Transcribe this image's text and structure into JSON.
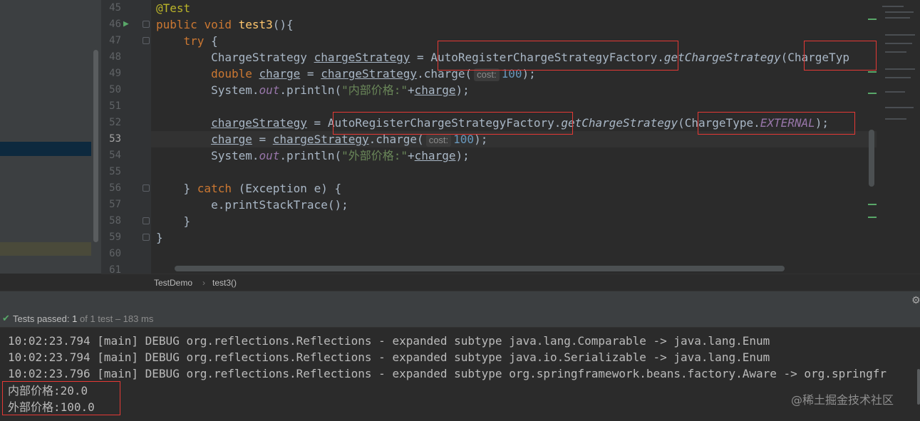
{
  "gutter": {
    "line_numbers": [
      "45",
      "46",
      "47",
      "48",
      "49",
      "50",
      "51",
      "52",
      "53",
      "54",
      "55",
      "56",
      "57",
      "58",
      "59",
      "60",
      "61"
    ],
    "current_line": "53"
  },
  "code": {
    "l45": "@Test",
    "l46_kw1": "public",
    "l46_kw2": "void",
    "l46_fn": "test3",
    "l46_rest": "(){",
    "l47_kw": "try",
    "l47_rest": " {",
    "l48_type": "ChargeStrategy ",
    "l48_var": "chargeStrategy",
    "l48_eq": " = ",
    "l48_factory": "AutoRegisterChargeStrategyFactory",
    "l48_dot": ".",
    "l48_method": "getChargeStrategy",
    "l48_arg": "(ChargeTyp",
    "l49_kw": "double",
    "l49_var": "charge",
    "l49_eq": " = ",
    "l49_obj": "chargeStrategy",
    "l49_call": ".charge(",
    "l49_hint": "cost:",
    "l49_num": "100",
    "l49_end": ");",
    "l50_a": "System.",
    "l50_out": "out",
    "l50_b": ".println(",
    "l50_str": "\"内部价格:\"",
    "l50_plus": "+",
    "l50_var": "charge",
    "l50_end": ");",
    "l52_var": "chargeStrategy",
    "l52_eq": " = ",
    "l52_factory": "AutoRegisterChargeStrategyFactory",
    "l52_dot": ".",
    "l52_method": "getChargeStrategy",
    "l52_arg1": "(ChargeType.",
    "l52_field": "EXTERNAL",
    "l52_end": ");",
    "l53_var": "charge",
    "l53_eq": " = ",
    "l53_obj": "chargeStrategy",
    "l53_call": ".charge(",
    "l53_hint": "cost:",
    "l53_num": "100",
    "l53_end": ");",
    "l54_a": "System.",
    "l54_out": "out",
    "l54_b": ".println(",
    "l54_str": "\"外部价格:\"",
    "l54_plus": "+",
    "l54_var": "charge",
    "l54_end": ");",
    "l56_a": "} ",
    "l56_kw": "catch",
    "l56_b": " (Exception e) {",
    "l57": "e.printStackTrace();",
    "l58": "}",
    "l59": "}"
  },
  "breadcrumb": {
    "cls": "TestDemo",
    "sep": "›",
    "method": "test3()"
  },
  "run": {
    "status_prefix": "Tests passed:",
    "status_count": "1",
    "status_suffix": "of 1 test – 183 ms",
    "console": [
      "10:02:23.794 [main] DEBUG org.reflections.Reflections - expanded subtype java.lang.Comparable -> java.lang.Enum",
      "10:02:23.794 [main] DEBUG org.reflections.Reflections - expanded subtype java.io.Serializable -> java.lang.Enum",
      "10:02:23.796 [main] DEBUG org.reflections.Reflections - expanded subtype org.springframework.beans.factory.Aware -> org.springfr",
      "内部价格:20.0",
      "外部价格:100.0"
    ],
    "watermark": "@稀土掘金技术社区"
  },
  "colors": {
    "editor_bg": "#2b2b2b",
    "keyword": "#cc7832",
    "string": "#6a8759",
    "number": "#6897bb",
    "highlight_box": "#e53935",
    "pass_green": "#59a869"
  }
}
